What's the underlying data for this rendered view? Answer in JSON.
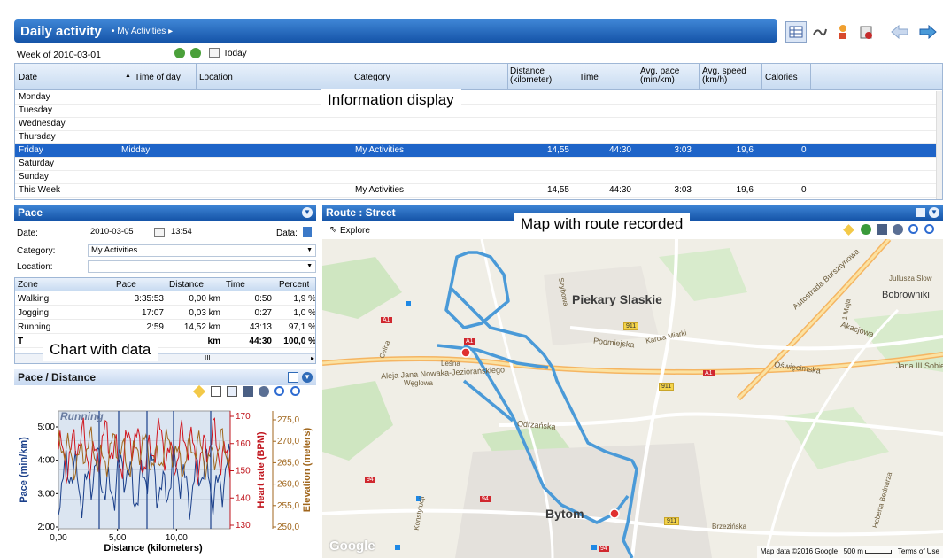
{
  "header": {
    "title": "Daily activity",
    "crumb": "My Activities",
    "week_label": "Week of 2010-03-01",
    "today_label": "Today"
  },
  "table": {
    "columns": [
      "Date",
      "Time of day",
      "Location",
      "Category",
      "Distance (kilometer)",
      "Time",
      "Avg. pace (min/km)",
      "Avg. speed (km/h)",
      "Calories"
    ],
    "rows": [
      {
        "date": "Monday",
        "tod": "",
        "loc": "",
        "cat": "",
        "dist": "",
        "time": "",
        "pace": "",
        "speed": "",
        "cal": ""
      },
      {
        "date": "Tuesday",
        "tod": "",
        "loc": "",
        "cat": "",
        "dist": "",
        "time": "",
        "pace": "",
        "speed": "",
        "cal": ""
      },
      {
        "date": "Wednesday",
        "tod": "",
        "loc": "",
        "cat": "",
        "dist": "",
        "time": "",
        "pace": "",
        "speed": "",
        "cal": ""
      },
      {
        "date": "Thursday",
        "tod": "",
        "loc": "",
        "cat": "",
        "dist": "",
        "time": "",
        "pace": "",
        "speed": "",
        "cal": ""
      },
      {
        "date": "Friday",
        "tod": "Midday",
        "loc": "",
        "cat": "My Activities",
        "dist": "14,55",
        "time": "44:30",
        "pace": "3:03",
        "speed": "19,6",
        "cal": "0"
      },
      {
        "date": "Saturday",
        "tod": "",
        "loc": "",
        "cat": "",
        "dist": "",
        "time": "",
        "pace": "",
        "speed": "",
        "cal": ""
      },
      {
        "date": "Sunday",
        "tod": "",
        "loc": "",
        "cat": "",
        "dist": "",
        "time": "",
        "pace": "",
        "speed": "",
        "cal": ""
      },
      {
        "date": "This Week",
        "tod": "",
        "loc": "",
        "cat": "My Activities",
        "dist": "14,55",
        "time": "44:30",
        "pace": "3:03",
        "speed": "19,6",
        "cal": "0"
      }
    ]
  },
  "callouts": {
    "info": "Information display",
    "map": "Map with route recorded",
    "chart": "Chart with data"
  },
  "pace_panel": {
    "title": "Pace",
    "date_label": "Date:",
    "date_value": "2010-03-05",
    "time_value": "13:54",
    "data_label": "Data:",
    "category_label": "Category:",
    "category_value": "My Activities",
    "location_label": "Location:",
    "location_value": "",
    "zone_columns": [
      "Zone",
      "Pace",
      "Distance",
      "Time",
      "Percent"
    ],
    "zones": [
      {
        "zone": "Walking",
        "pace": "3:35:53",
        "dist": "0,00 km",
        "time": "0:50",
        "pct": "1,9 %"
      },
      {
        "zone": "Jogging",
        "pace": "17:07",
        "dist": "0,03 km",
        "time": "0:27",
        "pct": "1,0 %"
      },
      {
        "zone": "Running",
        "pace": "2:59",
        "dist": "14,52 km",
        "time": "43:13",
        "pct": "97,1 %"
      },
      {
        "zone": "T",
        "pace": "",
        "dist": "km",
        "time": "44:30",
        "pct": "100,0 %"
      }
    ],
    "scroll_label": "III"
  },
  "chart_panel": {
    "title": "Pace / Distance"
  },
  "chart_data": {
    "type": "line",
    "annotation": "Running",
    "xlabel": "Distance (kilometers)",
    "xlim": [
      0,
      14.55
    ],
    "xticks": [
      "0,00",
      "5,00",
      "10,00"
    ],
    "y_axes": [
      {
        "label": "Pace (min/km)",
        "ticks": [
          "5:00",
          "4:00",
          "3:00",
          "2:00"
        ],
        "color": "#1a3f8a"
      },
      {
        "label": "Heart rate (BPM)",
        "ticks": [
          "170",
          "160",
          "150",
          "140",
          "130"
        ],
        "color": "#c0141c"
      },
      {
        "label": "Elevation (meters)",
        "ticks": [
          "275,0",
          "270,0",
          "265,0",
          "260,0",
          "255,0",
          "250,0"
        ],
        "color": "#a0661c"
      }
    ]
  },
  "map_panel": {
    "title": "Route : Street",
    "explore_label": "Explore",
    "labels": {
      "piekary": "Piekary Slaskie",
      "bytom": "Bytom",
      "bobrowniki": "Bobrowniki",
      "podmiejska": "Podmiejska",
      "aleja": "Aleja Jana Nowaka-Jeziorańskiego",
      "weglowa": "Węglowa",
      "odrzanska": "Odrzańska",
      "oswiecimska": "Oświęcimska",
      "jana3": "Jana III Sobiesk",
      "akacjowa": "Akacjowa",
      "karola": "Karola Miarki",
      "autostrada": "Autostrada Bursztynowa",
      "jullusza": "Jullusza Slow",
      "brzezinska": "Brzezińska",
      "maja": "1 Maja",
      "lesna": "Leśna",
      "celna": "Celna",
      "szybowa": "Szybowa",
      "konstytucji": "Konstytucji",
      "bednarza": "Heberta Bednarza",
      "google": "Google",
      "footer_data": "Map data ©2016 Google",
      "footer_scale": "500 m",
      "footer_terms": "Terms of Use"
    },
    "road_numbers": [
      "A1",
      "A1",
      "A1",
      "911",
      "911",
      "911",
      "94",
      "94",
      "94"
    ]
  },
  "colors": {
    "accent": "#1e64c8",
    "route": "#4a9ad8"
  }
}
